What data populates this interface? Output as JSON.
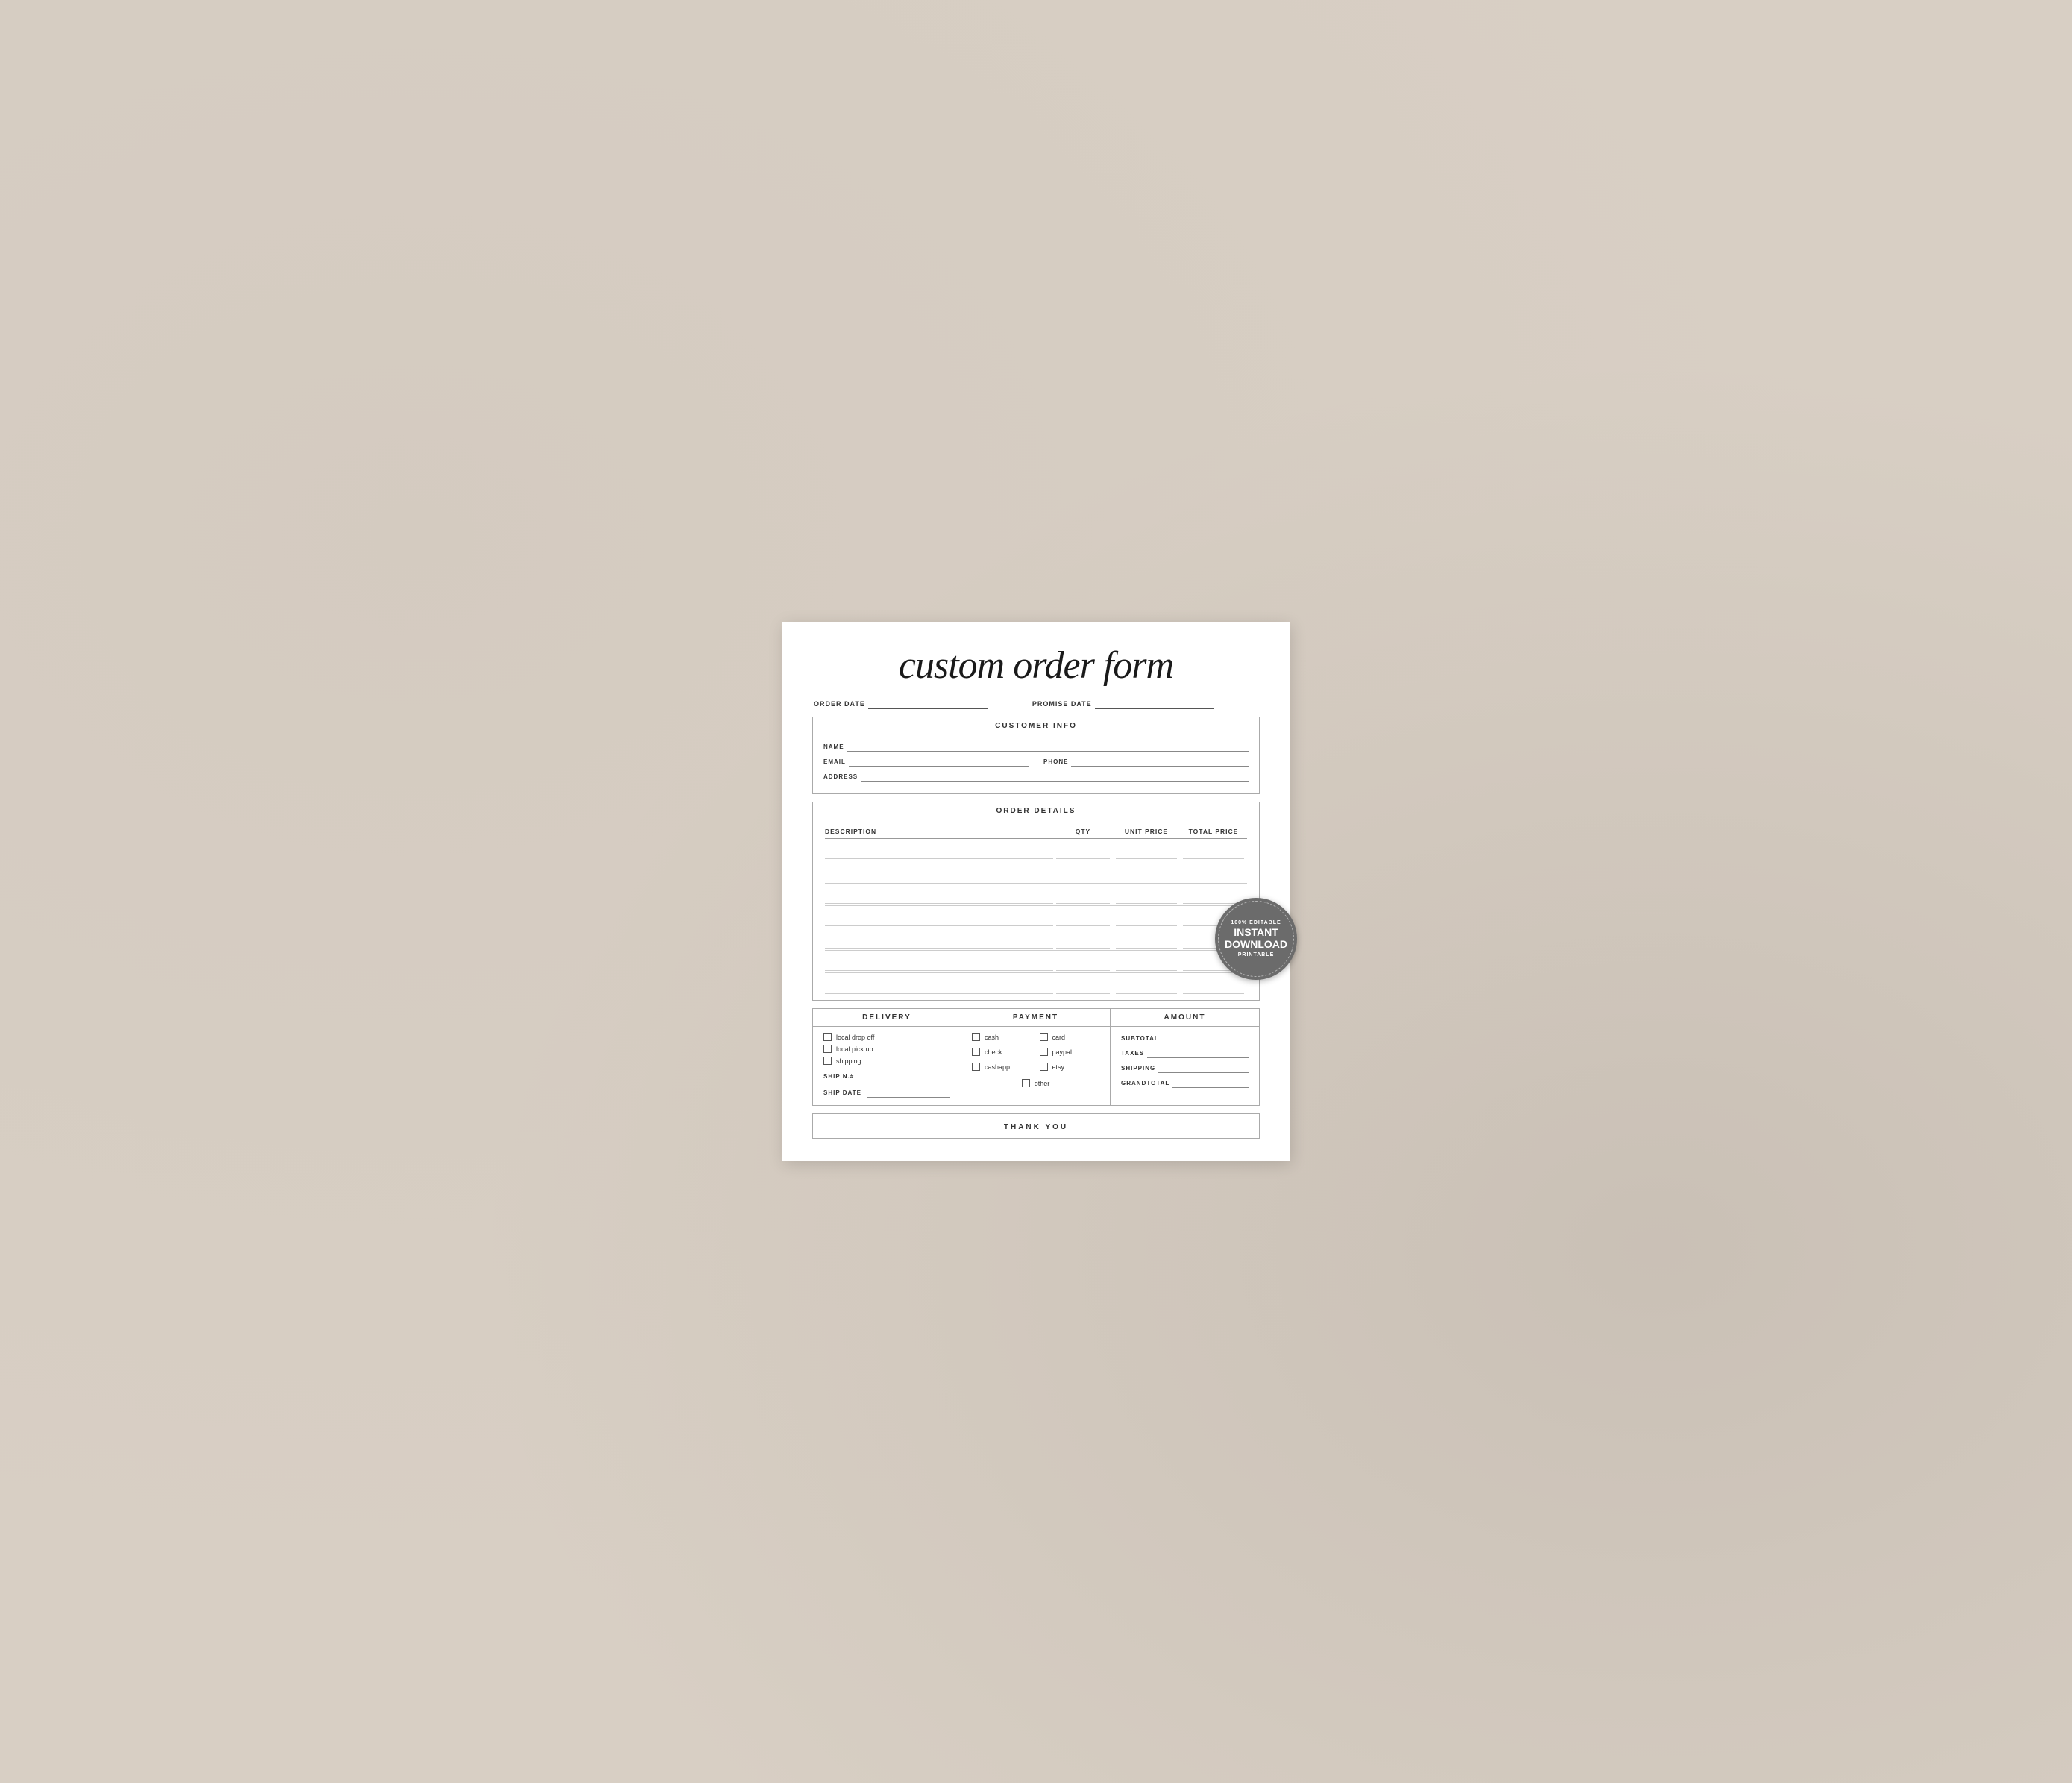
{
  "title": "custom order form",
  "dates": {
    "order_date_label": "ORDER DATE",
    "promise_date_label": "PROMISE DATE"
  },
  "customer_info": {
    "header": "CUSTOMER INFO",
    "name_label": "NAME",
    "email_label": "EMAIL",
    "phone_label": "PHONE",
    "address_label": "ADDRESS"
  },
  "order_details": {
    "header": "ORDER DETAILS",
    "columns": [
      "DESCRIPTION",
      "QTY",
      "UNIT PRICE",
      "TOTAL PRICE"
    ]
  },
  "delivery": {
    "header": "DELIVERY",
    "options": [
      "local drop off",
      "local pick up",
      "shipping"
    ],
    "ship_n_label": "SHIP N.#",
    "ship_date_label": "SHIP DATE"
  },
  "payment": {
    "header": "PAYMENT",
    "options": [
      "cash",
      "card",
      "check",
      "paypal",
      "cashapp",
      "etsy",
      "other"
    ]
  },
  "amount": {
    "header": "AMOUNT",
    "subtotal_label": "SUBTOTAL",
    "taxes_label": "TAXES",
    "shipping_label": "SHIPPING",
    "grandtotal_label": "GRANDTOTAL"
  },
  "footer": {
    "text": "THANK YOU"
  },
  "badge": {
    "top": "100% EDITABLE",
    "main": "INSTANT\nDOWNLOAD",
    "bottom": "PRINTABLE"
  }
}
